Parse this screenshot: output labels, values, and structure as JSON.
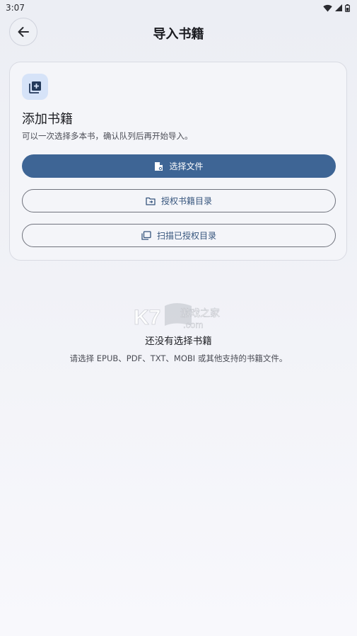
{
  "status_bar": {
    "time": "3:07"
  },
  "header": {
    "title": "导入书籍"
  },
  "add_card": {
    "title": "添加书籍",
    "description": "可以一次选择多本书，确认队列后再开始导入。",
    "buttons": {
      "select_files": "选择文件",
      "authorize_dir": "授权书籍目录",
      "scan_dirs": "扫描已授权目录"
    }
  },
  "empty_state": {
    "title": "还没有选择书籍",
    "description": "请选择 EPUB、PDF、TXT、MOBI 或其他支持的书籍文件。"
  },
  "watermark": {
    "text": "K73游戏之家 .com"
  },
  "colors": {
    "primary": "#3e6595",
    "outline_text": "#36557d",
    "icon_box": "#d6e3f8"
  },
  "icons": [
    "back-arrow-icon",
    "library-add-icon",
    "file-icon",
    "folder-open-icon",
    "library-icon",
    "wifi-icon",
    "signal-icon",
    "battery-icon"
  ]
}
